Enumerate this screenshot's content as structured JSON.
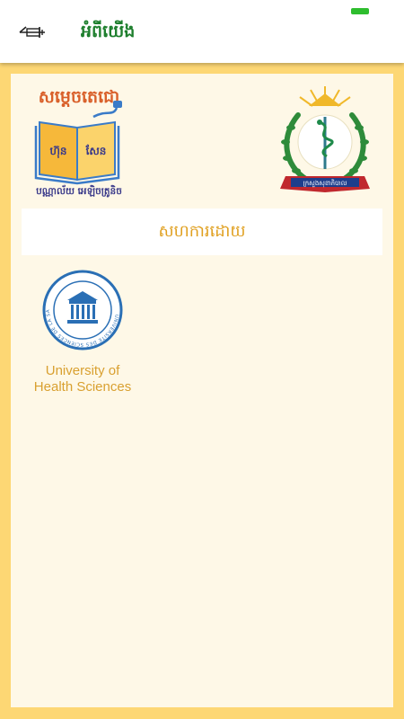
{
  "appbar": {
    "title": "អំពីយើង",
    "back_icon": "back-arrow-icon"
  },
  "status": {
    "battery_color": "#2EBD2E"
  },
  "header": {
    "left_logo": {
      "name": "samdech-techo-library-logo",
      "top_text": "សម្តេចតេជោ",
      "book_text_left": "ហ៊ុន",
      "book_text_right": "សែន",
      "bottom_text": "បណ្ណាល័យ អេឡិចត្រូនិច"
    },
    "right_logo": {
      "name": "ministry-of-health-emblem",
      "ribbon_text": "ក្រសួងសុខាភិបាល"
    }
  },
  "section": {
    "title": "សហការដោយ"
  },
  "partners": [
    {
      "name": "University of\nHealth Sciences",
      "logo_icon": "uhs-seal-icon",
      "seal_text": "UNIVERSITE DES SCIENCES DE LA SANTE"
    }
  ],
  "colors": {
    "background": "#FDD774",
    "content": "#FEF8E7",
    "title_green": "#1E7F2E",
    "accent_gold": "#E0A020",
    "seal_blue": "#2A6FB5"
  }
}
